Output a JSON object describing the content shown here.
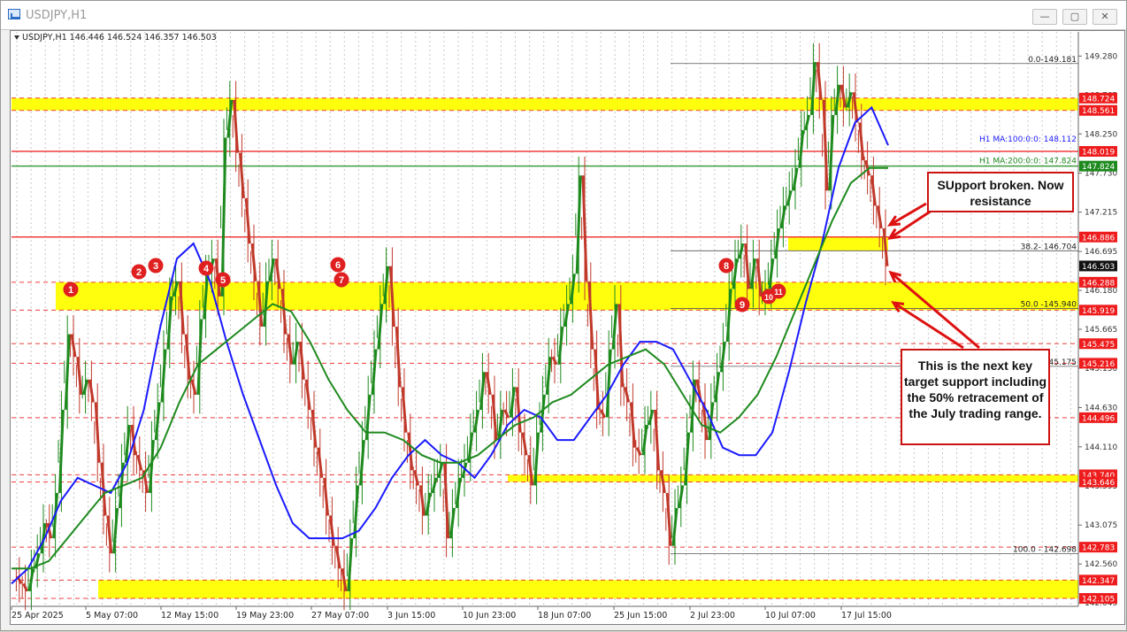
{
  "window": {
    "title": "USDJPY,H1",
    "buttons": {
      "minimize": "—",
      "maximize": "▢",
      "close": "✕"
    }
  },
  "chart_data": {
    "type": "line",
    "header": "USDJPY,H1  146.446 146.524 146.357 146.503",
    "ylim": [
      142.0,
      149.6
    ],
    "y_ticks": [
      149.28,
      148.765,
      148.25,
      147.73,
      147.215,
      146.695,
      146.18,
      145.665,
      145.15,
      144.63,
      144.11,
      143.595,
      143.075,
      142.56,
      142.045
    ],
    "x_ticks": [
      "25 Apr 2025",
      "5 May 07:00",
      "12 May 15:00",
      "19 May 23:00",
      "27 May 07:00",
      "3 Jun 15:00",
      "10 Jun 23:00",
      "18 Jun 07:00",
      "25 Jun 15:00",
      "2 Jul 23:00",
      "10 Jul 07:00",
      "17 Jul 15:00"
    ],
    "series": [
      {
        "name": "USDJPY,H1",
        "values": [
          142.4,
          142.3,
          142.2,
          142.5,
          142.7,
          143.1,
          142.9,
          143.5,
          144.6,
          145.6,
          145.3,
          144.8,
          145.0,
          144.7,
          143.9,
          143.2,
          142.7,
          143.3,
          143.9,
          144.4,
          144.0,
          143.8,
          143.5,
          144.2,
          144.7,
          145.4,
          146.1,
          146.3,
          145.6,
          145.0,
          144.8,
          145.8,
          146.4,
          146.6,
          146.1,
          148.2,
          148.7,
          148.0,
          147.4,
          146.8,
          146.3,
          145.7,
          146.3,
          146.6,
          146.2,
          145.6,
          145.2,
          145.5,
          145.0,
          144.6,
          144.1,
          143.7,
          143.2,
          142.8,
          142.5,
          142.2,
          142.9,
          143.6,
          144.2,
          144.8,
          145.4,
          146.0,
          146.5,
          145.7,
          144.9,
          144.3,
          143.8,
          143.6,
          143.2,
          143.5,
          143.7,
          143.9,
          142.9,
          143.3,
          143.7,
          143.9,
          144.3,
          144.6,
          145.1,
          144.8,
          144.2,
          144.6,
          144.5,
          144.9,
          144.3,
          144.0,
          143.6,
          144.3,
          144.8,
          145.3,
          145.2,
          145.7,
          146.0,
          146.4,
          147.7,
          146.3,
          145.4,
          144.6,
          144.5,
          145.4,
          146.0,
          144.9,
          144.7,
          144.1,
          144.0,
          144.4,
          144.6,
          143.8,
          143.5,
          142.8,
          143.3,
          143.6,
          144.3,
          145.0,
          144.7,
          144.2,
          144.7,
          145.1,
          145.5,
          146.2,
          146.6,
          146.8,
          146.2,
          146.6,
          146.1,
          146.2,
          146.6,
          147.0,
          147.3,
          147.5,
          147.8,
          148.3,
          148.5,
          149.2,
          148.7,
          147.5,
          148.5,
          148.9,
          148.6,
          148.8,
          148.4,
          147.9,
          147.7,
          147.3,
          147.0,
          146.5
        ]
      },
      {
        "name": "H1 MA:100:0:0",
        "values": [
          142.3,
          142.5,
          142.9,
          143.4,
          143.7,
          143.6,
          143.5,
          143.9,
          144.6,
          145.7,
          146.6,
          146.8,
          146.3,
          145.5,
          144.8,
          144.2,
          143.6,
          143.1,
          142.9,
          142.9,
          142.9,
          143.0,
          143.3,
          143.7,
          144.0,
          144.2,
          144.0,
          143.9,
          143.7,
          144.0,
          144.4,
          144.6,
          144.5,
          144.2,
          144.2,
          144.5,
          144.8,
          145.2,
          145.5,
          145.5,
          145.4,
          145.0,
          144.6,
          144.1,
          144.0,
          144.0,
          144.3,
          145.1,
          146.0,
          146.8,
          147.8,
          148.4,
          148.6,
          148.1
        ]
      },
      {
        "name": "H1 MA:200:0:0",
        "values": [
          142.5,
          142.5,
          142.6,
          142.9,
          143.2,
          143.5,
          143.6,
          143.7,
          144.1,
          144.7,
          145.2,
          145.4,
          145.6,
          145.8,
          146.0,
          145.9,
          145.5,
          145.0,
          144.6,
          144.3,
          144.3,
          144.2,
          144.0,
          143.9,
          143.9,
          144.0,
          144.2,
          144.4,
          144.5,
          144.7,
          144.8,
          145.0,
          145.2,
          145.3,
          145.4,
          145.2,
          144.8,
          144.4,
          144.3,
          144.5,
          144.8,
          145.3,
          145.9,
          146.5,
          147.1,
          147.6,
          147.8,
          147.8
        ]
      }
    ],
    "levels": [
      {
        "value": "148.724",
        "color": "#ee1c1c"
      },
      {
        "value": "148.561",
        "color": "#ee1c1c"
      },
      {
        "value": "148.019",
        "color": "#ee1c1c"
      },
      {
        "value": "147.824",
        "color": "#1e8a1e"
      },
      {
        "value": "146.886",
        "color": "#ee1c1c"
      },
      {
        "value": "146.503",
        "color": "#111111"
      },
      {
        "value": "146.288",
        "color": "#ee1c1c"
      },
      {
        "value": "145.919",
        "color": "#ee1c1c"
      },
      {
        "value": "145.475",
        "color": "#ee1c1c"
      },
      {
        "value": "145.216",
        "color": "#ee1c1c"
      },
      {
        "value": "144.496",
        "color": "#ee1c1c"
      },
      {
        "value": "143.740",
        "color": "#ee1c1c"
      },
      {
        "value": "143.646",
        "color": "#ee1c1c"
      },
      {
        "value": "142.783",
        "color": "#ee1c1c"
      },
      {
        "value": "142.347",
        "color": "#ee1c1c"
      },
      {
        "value": "142.105",
        "color": "#ee1c1c"
      }
    ],
    "zones": [
      {
        "from": 148.561,
        "to": 148.724
      },
      {
        "from": 145.919,
        "to": 146.288
      },
      {
        "from": 142.105,
        "to": 142.347
      },
      {
        "from": 146.704,
        "to": 146.886
      },
      {
        "from": 143.646,
        "to": 143.74
      }
    ],
    "fib_levels": [
      {
        "label": "0.0-149.181",
        "value": 149.181
      },
      {
        "label": "38.2- 146.704",
        "value": 146.704
      },
      {
        "label": "50.0 -145.940",
        "value": 145.94
      },
      {
        "label": "145.175",
        "value": 145.175
      },
      {
        "label": "100.0 - 142.698",
        "value": 142.698
      }
    ],
    "ma_labels": [
      {
        "text": "H1 MA:100:0:0: 148.112",
        "color": "#1a1aff"
      },
      {
        "text": "H1 MA:200:0:0: 147.824",
        "color": "#1e8a1e"
      }
    ],
    "markers": [
      "1",
      "2",
      "3",
      "4",
      "5",
      "6",
      "7",
      "8",
      "9",
      "10",
      "11"
    ],
    "annotations": [
      "SUpport broken. Now resistance",
      "This is the next key target support including the 50% retracement of the July trading range."
    ],
    "grid": true,
    "colors": {
      "up": "#1e8a1e",
      "down": "#c0392b",
      "ma100": "#1a1aff",
      "ma200": "#1e8a1e",
      "zone": "#ffff00"
    }
  }
}
